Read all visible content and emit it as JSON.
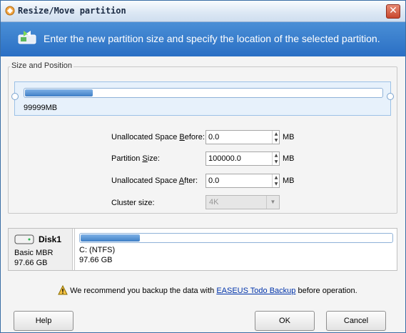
{
  "window": {
    "title": "Resize/Move partition",
    "close_glyph": "✕"
  },
  "banner": {
    "text": "Enter the new partition size and specify the location of the selected partition."
  },
  "size_position": {
    "group_label": "Size and Position",
    "partition_size_label": "99999MB",
    "bar_fill_fraction": 0.19
  },
  "fields": {
    "unallocated_before": {
      "label_pre": "Unallocated Space ",
      "label_key": "B",
      "label_post": "efore:",
      "value": "0.0",
      "unit": "MB"
    },
    "partition_size": {
      "label_pre": "Partition ",
      "label_key": "S",
      "label_post": "ize:",
      "value": "100000.0",
      "unit": "MB"
    },
    "unallocated_after": {
      "label_pre": "Unallocated Space ",
      "label_key": "A",
      "label_post": "fter:",
      "value": "0.0",
      "unit": "MB"
    },
    "cluster_size": {
      "label": "Cluster size:",
      "value": "4K"
    }
  },
  "disk": {
    "name": "Disk1",
    "type": "Basic MBR",
    "size": "97.66 GB",
    "partition_label": "C: (NTFS)",
    "partition_size": "97.66 GB",
    "bar_fill_fraction": 0.19
  },
  "warning": {
    "pre": "We recommend you backup the data with ",
    "link": "EASEUS Todo Backup",
    "post": " before operation."
  },
  "buttons": {
    "help": "Help",
    "ok": "OK",
    "cancel": "Cancel"
  },
  "colors": {
    "banner": "#2a6fc4",
    "bar": "#3f7fc6",
    "close": "#c8462d"
  }
}
